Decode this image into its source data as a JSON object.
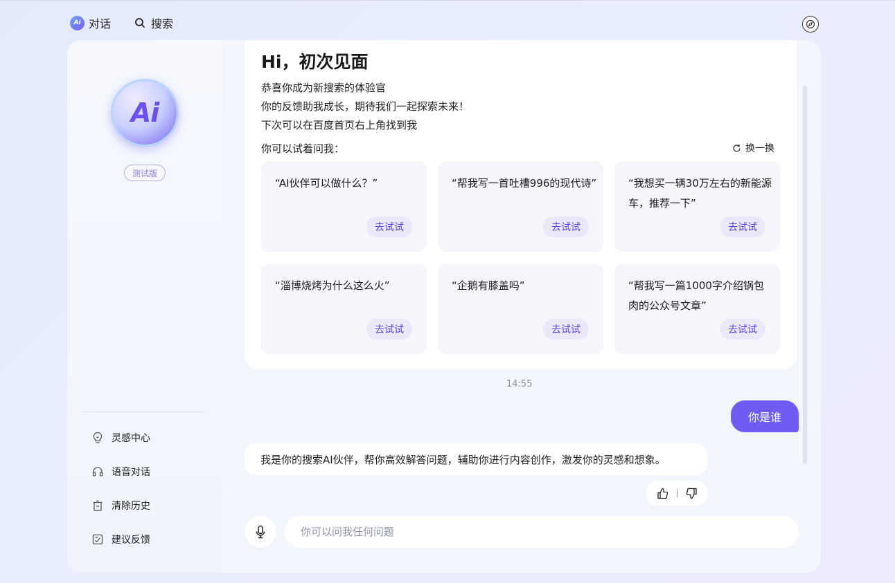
{
  "nav": {
    "logo_text": "Ai",
    "chat_label": "对话",
    "search_label": "搜索"
  },
  "sidebar": {
    "avatar_text": "Ai",
    "badge": "测试版",
    "items": [
      {
        "label": "灵感中心",
        "icon": "lightbulb-icon"
      },
      {
        "label": "语音对话",
        "icon": "headphones-icon"
      },
      {
        "label": "清除历史",
        "icon": "trash-icon"
      },
      {
        "label": "建议反馈",
        "icon": "feedback-icon"
      }
    ]
  },
  "welcome": {
    "title": "Hi，初次见面",
    "lines": [
      "恭喜你成为新搜索的体验官",
      "你的反馈助我成长，期待我们一起探索未来！",
      "下次可以在百度首页右上角找到我"
    ],
    "try_label": "你可以试着问我：",
    "refresh_label": "换一换"
  },
  "prompts": [
    {
      "text": "“AI伙伴可以做什么？”",
      "button": "去试试"
    },
    {
      "text": "“帮我写一首吐槽996的现代诗”",
      "button": "去试试"
    },
    {
      "text": "“我想买一辆30万左右的新能源车，推荐一下”",
      "button": "去试试"
    },
    {
      "text": "“淄博烧烤为什么这么火”",
      "button": "去试试"
    },
    {
      "text": "“企鹅有膝盖吗”",
      "button": "去试试"
    },
    {
      "text": "“帮我写一篇1000字介绍锅包肉的公众号文章”",
      "button": "去试试"
    }
  ],
  "conversation": {
    "timestamp": "14:55",
    "user_message": "你是谁",
    "bot_message": "我是你的搜索AI伙伴，帮你高效解答问题，辅助你进行内容创作，激发你的灵感和想象。"
  },
  "input": {
    "placeholder": "你可以问我任何问题",
    "value": ""
  },
  "colors": {
    "accent": "#6e5cf5",
    "try_button_bg": "#ebe8fb",
    "try_button_text": "#5b44e6"
  }
}
